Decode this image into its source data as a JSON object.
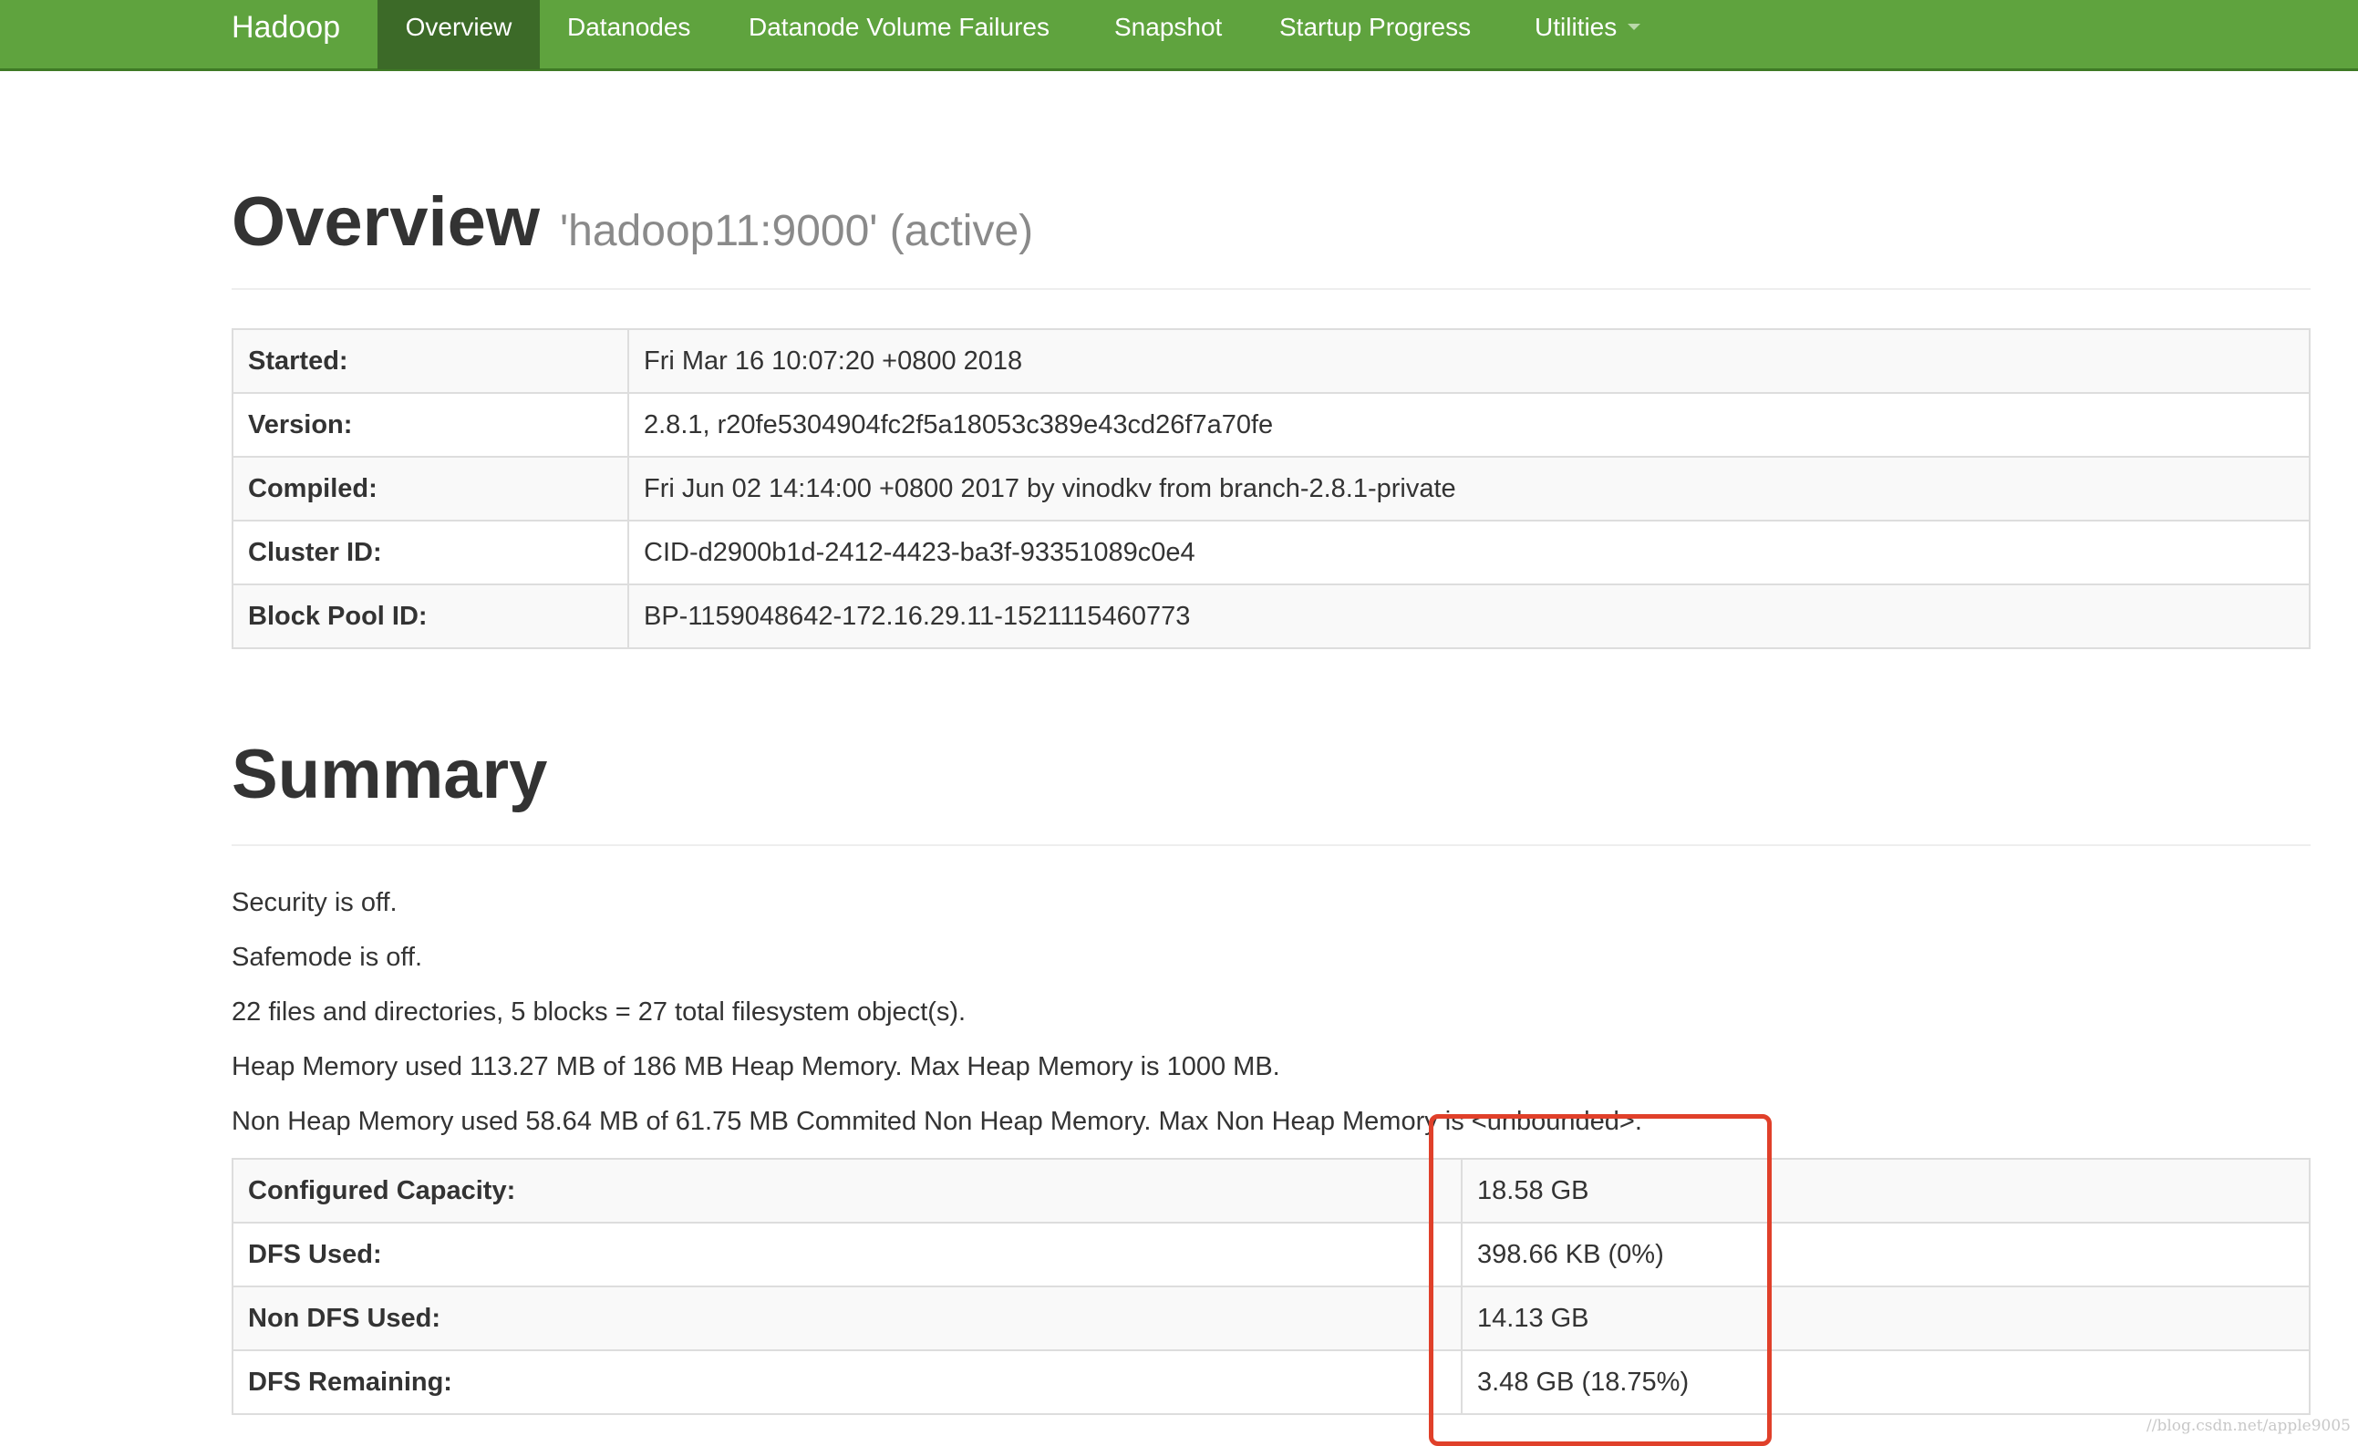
{
  "navbar": {
    "brand": "Hadoop",
    "items": [
      {
        "label": "Overview",
        "active": true
      },
      {
        "label": "Datanodes",
        "active": false
      },
      {
        "label": "Datanode Volume Failures",
        "active": false
      },
      {
        "label": "Snapshot",
        "active": false
      },
      {
        "label": "Startup Progress",
        "active": false
      },
      {
        "label": "Utilities",
        "active": false,
        "dropdown": true
      }
    ]
  },
  "overview": {
    "title": "Overview",
    "subtitle": "'hadoop11:9000' (active)",
    "rows": [
      {
        "label": "Started:",
        "value": "Fri Mar 16 10:07:20 +0800 2018"
      },
      {
        "label": "Version:",
        "value": "2.8.1, r20fe5304904fc2f5a18053c389e43cd26f7a70fe"
      },
      {
        "label": "Compiled:",
        "value": "Fri Jun 02 14:14:00 +0800 2017 by vinodkv from branch-2.8.1-private"
      },
      {
        "label": "Cluster ID:",
        "value": "CID-d2900b1d-2412-4423-ba3f-93351089c0e4"
      },
      {
        "label": "Block Pool ID:",
        "value": "BP-1159048642-172.16.29.11-1521115460773"
      }
    ]
  },
  "summary": {
    "title": "Summary",
    "lines": [
      "Security is off.",
      "Safemode is off.",
      "22 files and directories, 5 blocks = 27 total filesystem object(s).",
      "Heap Memory used 113.27 MB of 186 MB Heap Memory. Max Heap Memory is 1000 MB.",
      "Non Heap Memory used 58.64 MB of 61.75 MB Commited Non Heap Memory. Max Non Heap Memory is <unbounded>."
    ],
    "rows": [
      {
        "label": "Configured Capacity:",
        "value": "18.58 GB"
      },
      {
        "label": "DFS Used:",
        "value": "398.66 KB (0%)"
      },
      {
        "label": "Non DFS Used:",
        "value": "14.13 GB"
      },
      {
        "label": "DFS Remaining:",
        "value": "3.48 GB (18.75%)"
      }
    ]
  },
  "annotation": {
    "color": "#e0402a"
  },
  "watermark": "//blog.csdn.net/apple9005"
}
